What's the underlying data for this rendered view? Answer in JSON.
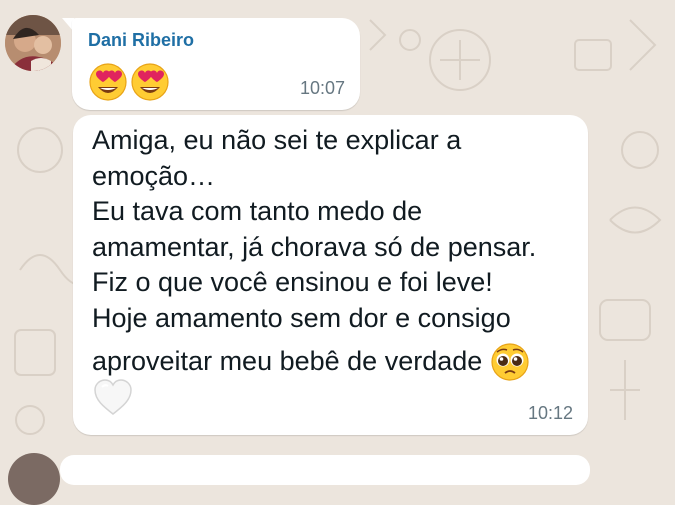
{
  "chat": {
    "messages": [
      {
        "sender": "Dani Ribeiro",
        "emojis": [
          "heart-eyes-emoji",
          "heart-eyes-emoji"
        ],
        "time": "10:07"
      },
      {
        "lines": [
          "Amiga, eu não sei te explicar a",
          "emoção…",
          "Eu tava com tanto medo de",
          "amamentar, já chorava só de pensar.",
          "Fiz o que você ensinou e foi leve!",
          "Hoje amamento sem dor e consigo",
          "aproveitar meu bebê de verdade"
        ],
        "inline_emoji": "pleading-face-emoji",
        "reaction_emoji": "white-heart-emoji",
        "time": "10:12"
      }
    ]
  },
  "colors": {
    "wallpaper": "#ece5dd",
    "bubble": "#ffffff",
    "sender_name": "#1f6fa5",
    "timestamp": "#667781",
    "text": "#111b21"
  }
}
